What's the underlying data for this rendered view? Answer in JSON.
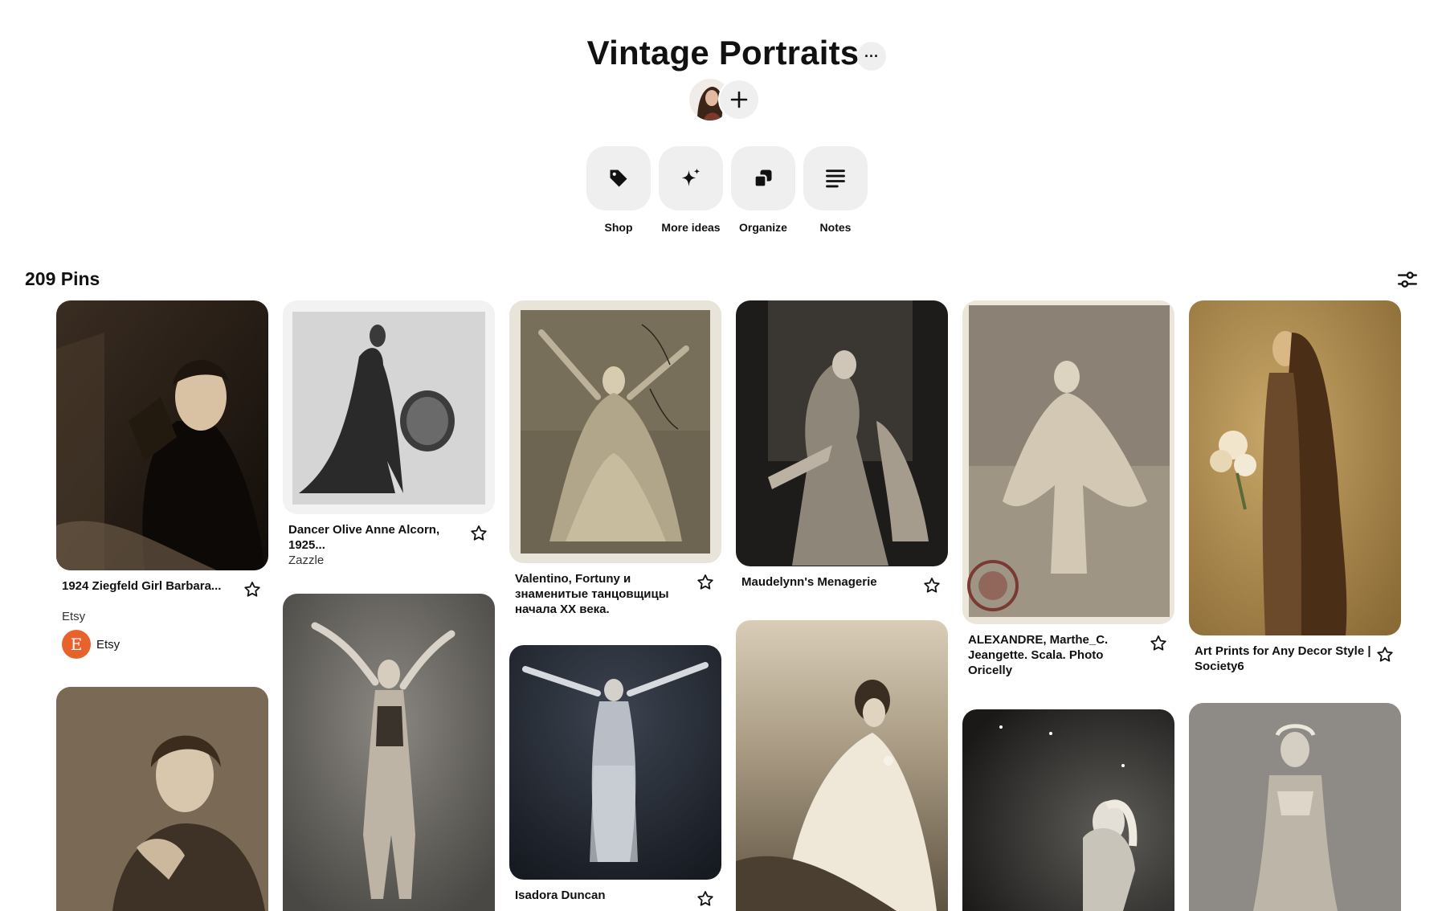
{
  "board": {
    "title": "Vintage Portraits",
    "more_label": "···",
    "pin_count": "209 Pins"
  },
  "tools": [
    {
      "label": "Shop",
      "icon": "tag-icon"
    },
    {
      "label": "More ideas",
      "icon": "sparkle-icon"
    },
    {
      "label": "Organize",
      "icon": "organize-icon"
    },
    {
      "label": "Notes",
      "icon": "notes-icon"
    }
  ],
  "pins": [
    {
      "title": "1924 Ziegfeld Girl Barbara...",
      "subtitle": "Etsy",
      "source_name": "Etsy",
      "source_logo": "E",
      "source_color": "#e8622c"
    },
    {
      "title": "Dancer Olive Anne Alcorn, 1925...",
      "subtitle": "Zazzle"
    },
    {
      "title": "Valentino, Fortuny и знаменитые танцовщицы начала XX века."
    },
    {
      "title": "Maudelynn's Menagerie"
    },
    {
      "title": "ALEXANDRE, Marthe_C. Jeangette. Scala. Photo Oricelly"
    },
    {
      "title": "Art Prints for Any Decor Style | Society6"
    },
    {
      "title": ""
    },
    {
      "title": ""
    },
    {
      "title": "Isadora Duncan"
    },
    {
      "title": ""
    },
    {
      "title": ""
    },
    {
      "title": ""
    }
  ],
  "colors": {
    "tool_bg": "#efefef",
    "etsy_orange": "#e8622c",
    "text": "#111111"
  }
}
